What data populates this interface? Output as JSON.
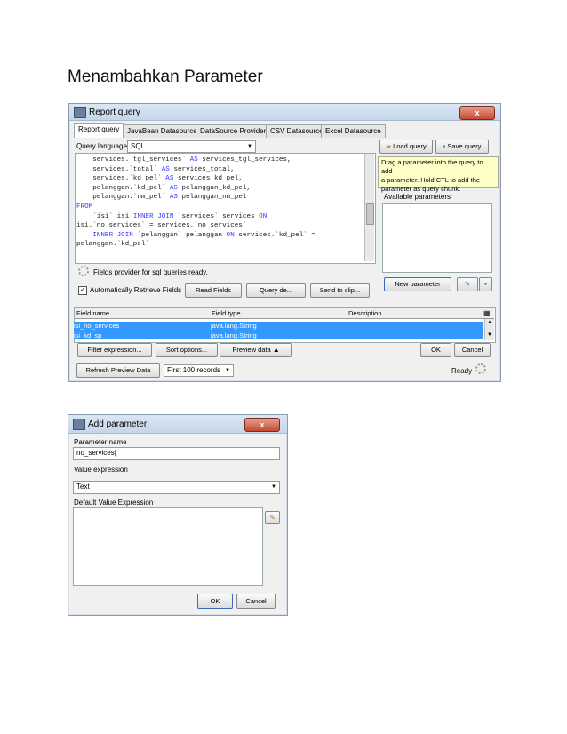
{
  "heading": "Menambahkan Parameter",
  "report_query": {
    "title": "Report query",
    "close": "x",
    "tabs": [
      "Report query",
      "JavaBean Datasource",
      "DataSource Provider",
      "CSV Datasource",
      "Excel Datasource"
    ],
    "query_language_label": "Query language",
    "query_language_value": "SQL",
    "load_query": "Load query",
    "save_query": "Save query",
    "sql_lines": [
      "    services.`tgl_services` AS services_tgl_services,",
      "    services.`total` AS services_total,",
      "    services.`kd_pel` AS services_kd_pel,",
      "    pelanggan.`kd_pel` AS pelanggan_kd_pel,",
      "    pelanggan.`nm_pel` AS pelanggan_nm_pel",
      "FROM",
      "    `isi` isi INNER JOIN `services` services ON",
      "isi.`no_services` = services.`no_services`",
      "    INNER JOIN `pelanggan` pelanggan ON services.`kd_pel` =",
      "pelanggan.`kd_pel`"
    ],
    "hint": [
      "Drag a parameter into the query to add",
      "a parameter. Hold CTL to add the",
      "parameter as query chunk."
    ],
    "available_parameters": "Available parameters",
    "fields_status": "Fields provider for sql queries ready.",
    "auto_retrieve": "Automatically Retrieve Fields",
    "read_fields": "Read Fields",
    "query_designer": "Query de...",
    "send_to_clip": "Send to clip...",
    "new_parameter": "New parameter",
    "columns": [
      "Field name",
      "Field type",
      "Description"
    ],
    "rows": [
      {
        "name": "isi_no_services",
        "type": "java.lang.String",
        "desc": ""
      },
      {
        "name": "isi_kd_sp",
        "type": "java.lang.String",
        "desc": ""
      }
    ],
    "filter_expression": "Filter expression...",
    "sort_options": "Sort options...",
    "preview_data": "Preview data",
    "ok": "OK",
    "cancel": "Cancel",
    "refresh_preview": "Refresh Preview Data",
    "first_records": "First 100 records",
    "status": "Ready"
  },
  "add_parameter": {
    "title": "Add parameter",
    "close": "x",
    "parameter_name_label": "Parameter name",
    "parameter_name_value": "no_services",
    "value_expression_label": "Value expression",
    "value_expression_value": "Text",
    "default_value_label": "Default Value Expression",
    "ok": "OK",
    "cancel": "Cancel"
  }
}
